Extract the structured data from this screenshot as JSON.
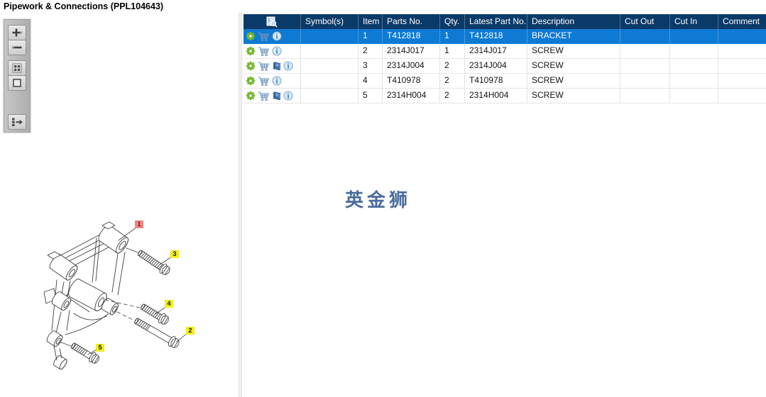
{
  "title": "Pipework & Connections (PPL104643)",
  "watermark": "英金狮",
  "colors": {
    "header_navy": "#0a3a68",
    "selection_blue": "#0e7ad4",
    "callout_yellow": "#f1ee1a",
    "callout_red_bg": "#e98980",
    "callout_red_fg": "#7d0f0f",
    "watermark_blue": "#4a6c9c",
    "gear_green": "#74b62e",
    "cart_blue": "#7195bd",
    "book_blue": "#3b73b4",
    "info_blue": "#2a6fae"
  },
  "toolbar": {
    "buttons": [
      {
        "name": "zoom-in",
        "icon": "plus-icon"
      },
      {
        "name": "zoom-out",
        "icon": "minus-icon"
      },
      {
        "name": "tile-view",
        "icon": "grid-icon"
      },
      {
        "name": "full-view",
        "icon": "square-icon"
      },
      {
        "name": "toggle-list-panel",
        "icon": "panel-arrow-icon"
      }
    ]
  },
  "table": {
    "columns": [
      "",
      "Symbol(s)",
      "Item",
      "Parts No.",
      "Qty.",
      "Latest Part No.",
      "Description",
      "Cut Out",
      "Cut In",
      "Comment"
    ],
    "rows": [
      {
        "icons": [
          "gear",
          "cart",
          "info"
        ],
        "symbols": "",
        "item": "1",
        "parts_no": "T412818",
        "qty": "1",
        "latest_part_no": "T412818",
        "description": "BRACKET",
        "cut_out": "",
        "cut_in": "",
        "comment": "",
        "selected": true
      },
      {
        "icons": [
          "gear",
          "cart",
          "info"
        ],
        "symbols": "",
        "item": "2",
        "parts_no": "2314J017",
        "qty": "1",
        "latest_part_no": "2314J017",
        "description": "SCREW",
        "cut_out": "",
        "cut_in": "",
        "comment": "",
        "selected": false
      },
      {
        "icons": [
          "gear",
          "cart",
          "book",
          "info"
        ],
        "symbols": "",
        "item": "3",
        "parts_no": "2314J004",
        "qty": "2",
        "latest_part_no": "2314J004",
        "description": "SCREW",
        "cut_out": "",
        "cut_in": "",
        "comment": "",
        "selected": false
      },
      {
        "icons": [
          "gear",
          "cart",
          "info"
        ],
        "symbols": "",
        "item": "4",
        "parts_no": "T410978",
        "qty": "2",
        "latest_part_no": "T410978",
        "description": "SCREW",
        "cut_out": "",
        "cut_in": "",
        "comment": "",
        "selected": false
      },
      {
        "icons": [
          "gear",
          "cart",
          "book",
          "info"
        ],
        "symbols": "",
        "item": "5",
        "parts_no": "2314H004",
        "qty": "2",
        "latest_part_no": "2314H004",
        "description": "SCREW",
        "cut_out": "",
        "cut_in": "",
        "comment": "",
        "selected": false
      }
    ]
  },
  "drawing": {
    "callouts": [
      {
        "label": "1",
        "state": "selected"
      },
      {
        "label": "2",
        "state": "normal"
      },
      {
        "label": "3",
        "state": "normal"
      },
      {
        "label": "4",
        "state": "normal"
      },
      {
        "label": "5",
        "state": "normal"
      }
    ]
  }
}
